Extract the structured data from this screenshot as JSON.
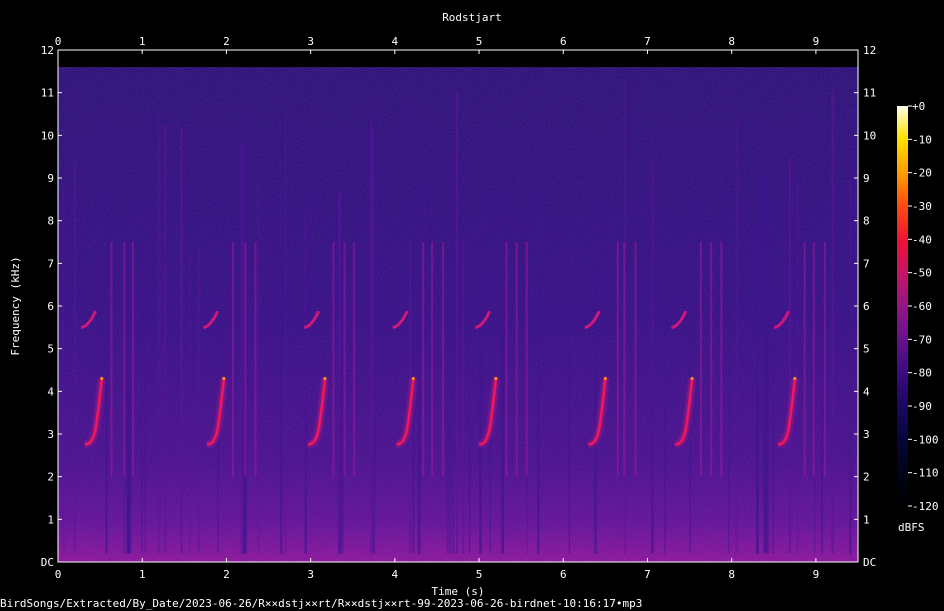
{
  "chart_data": {
    "type": "heatmap",
    "title": "Rodstjart",
    "xlabel": "Time (s)",
    "ylabel": "Frequency (kHz)",
    "xlim": [
      0,
      9.5
    ],
    "ylim": [
      0,
      12
    ],
    "x_ticks": [
      "0",
      "1",
      "2",
      "3",
      "4",
      "5",
      "6",
      "7",
      "8",
      "9"
    ],
    "y_ticks": [
      "DC",
      "1",
      "2",
      "3",
      "4",
      "5",
      "6",
      "7",
      "8",
      "9",
      "10",
      "11",
      "12"
    ],
    "colorbar": {
      "unit": "dBFS",
      "range": [
        -120,
        0
      ],
      "ticks": [
        "+0",
        "-10",
        "-20",
        "-30",
        "-40",
        "-50",
        "-60",
        "-70",
        "-80",
        "-90",
        "-100",
        "-110",
        "-120"
      ]
    },
    "song_phrase_starts_s": [
      0.32,
      1.77,
      2.97,
      4.02,
      5.0,
      6.3,
      7.33,
      8.55
    ],
    "song_components": [
      {
        "name": "chirp",
        "start_khz": 2.75,
        "end_khz": 4.3,
        "duration_s": 0.2
      },
      {
        "name": "upper note",
        "start_khz": 5.5,
        "end_khz": 5.85,
        "duration_s": 0.15
      }
    ],
    "peak_level_dbfs": -40,
    "noise_floor_dbfs": -100,
    "file_caption": "BirdSongs/Extracted/By_Date/2023-06-26/R××dstj××rt/R××dstj××rt-99-2023-06-26-birdnet-10:16:17•mp3",
    "colors": {
      "background": "#000000",
      "text": "#ffffff"
    }
  }
}
